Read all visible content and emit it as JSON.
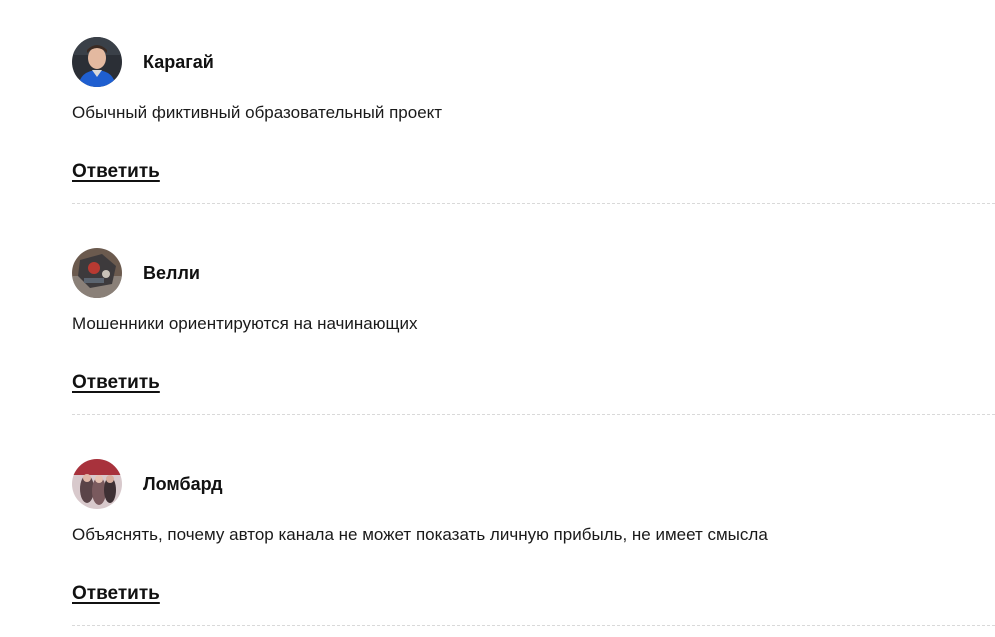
{
  "comments": [
    {
      "author": "Карагай",
      "avatar_icon": "user-photo-avatar",
      "text": "Обычный фиктивный образовательный проект",
      "reply_label": "Ответить"
    },
    {
      "author": "Велли",
      "avatar_icon": "user-photo-avatar",
      "text": "Мошенники ориентируются на начинающих",
      "reply_label": "Ответить"
    },
    {
      "author": "Ломбард",
      "avatar_icon": "user-photo-avatar",
      "text": "Объяснять, почему автор канала не может показать личную прибыль, не имеет смысла",
      "reply_label": "Ответить"
    }
  ],
  "colors": {
    "text": "#111111",
    "divider": "#d9d9d9",
    "background": "#ffffff"
  }
}
